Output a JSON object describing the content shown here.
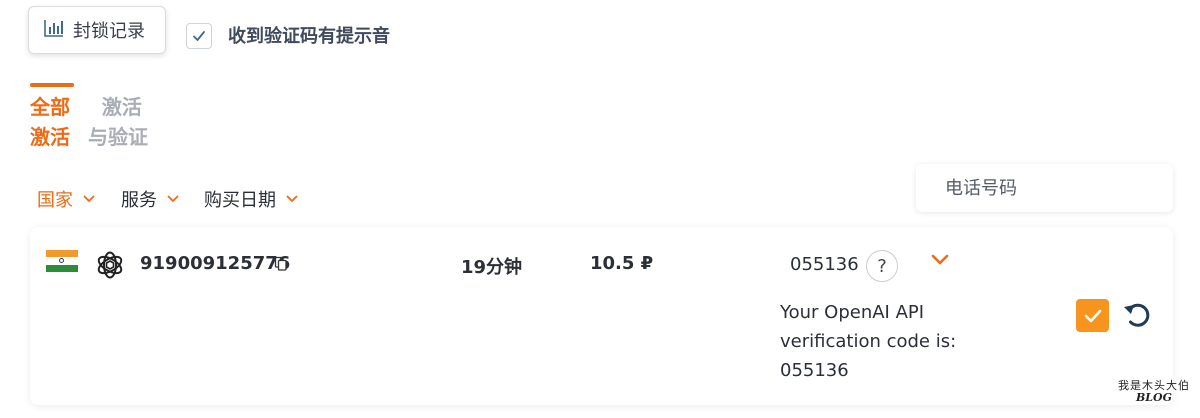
{
  "toolbar": {
    "block_log_label": "封锁记录",
    "block_log_icon": "bar-chart-icon",
    "sound_alert_label": "收到验证码有提示音",
    "sound_alert_checked": true
  },
  "tabs": [
    {
      "label": "全部\n激活",
      "active": true
    },
    {
      "label": "  激活\n与验证",
      "active": false
    }
  ],
  "filters": [
    {
      "label": "国家",
      "active": true
    },
    {
      "label": "服务",
      "active": false
    },
    {
      "label": "购买日期",
      "active": false
    }
  ],
  "search": {
    "placeholder": "电话号码"
  },
  "activation": {
    "country_flag": "india-flag-icon",
    "service_icon": "openai-icon",
    "phone_number": "919009125776",
    "duration": "19分钟",
    "price": "10.5 ₽",
    "code": "055136",
    "help_label": "?",
    "sms_text": "Your OpenAI API verification code is: 055136"
  },
  "watermark": {
    "line1": "我是木头大伯",
    "line2": "BLOG"
  },
  "colors": {
    "accent": "#ef6a14",
    "confirm": "#f7941d",
    "inactive_text": "#a9adb5",
    "icon_blue": "#1f3b57"
  }
}
